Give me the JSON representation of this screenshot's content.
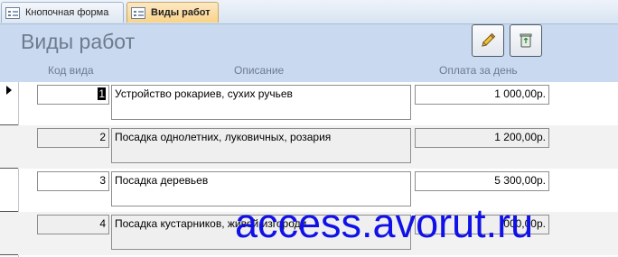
{
  "tabs": [
    {
      "label": "Кнопочная форма",
      "active": false
    },
    {
      "label": "Виды работ",
      "active": true
    }
  ],
  "header": {
    "title": "Виды работ",
    "columns": {
      "code": "Код вида",
      "description": "Описание",
      "payment": "Оплата за день"
    },
    "buttons": {
      "edit": "pencil-icon",
      "delete": "trash-icon"
    }
  },
  "rows": [
    {
      "code": "1",
      "description": "Устройство рокариев, сухих ручьев",
      "payment": "1 000,00р.",
      "current": true
    },
    {
      "code": "2",
      "description": "Посадка однолетних, луковичных, розария",
      "payment": "1 200,00р.",
      "current": false
    },
    {
      "code": "3",
      "description": "Посадка деревьев",
      "payment": "5 300,00р.",
      "current": false
    },
    {
      "code": "4",
      "description": "Посадка кустарников, живой изгороди",
      "payment": "000,00р.",
      "current": false
    }
  ],
  "watermark": "access.avorut.ru",
  "colors": {
    "header_bg": "#c9d9f0",
    "active_tab": "#f9d388",
    "watermark": "#1010e8"
  }
}
